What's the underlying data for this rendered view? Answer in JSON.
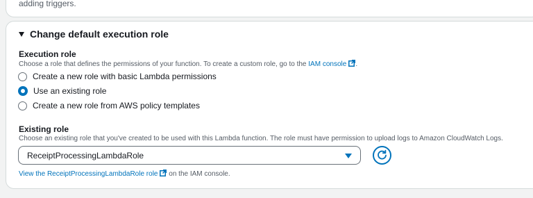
{
  "top_card": {
    "text": "adding triggers."
  },
  "section": {
    "title": "Change default execution role",
    "expanded": true
  },
  "execution_role": {
    "label": "Execution role",
    "description": "Choose a role that defines the permissions of your function. To create a custom role, go to the",
    "iam_link": "IAM console",
    "description_end": ".",
    "options": [
      {
        "label": "Create a new role with basic Lambda permissions",
        "checked": false
      },
      {
        "label": "Use an existing role",
        "checked": true
      },
      {
        "label": "Create a new role from AWS policy templates",
        "checked": false
      }
    ]
  },
  "existing_role": {
    "label": "Existing role",
    "description": "Choose an existing role that you've created to be used with this Lambda function. The role must have permission to upload logs to Amazon CloudWatch Logs.",
    "selected_value": "ReceiptProcessingLambdaRole",
    "view_link": "View the ReceiptProcessingLambdaRole role",
    "view_suffix": "on the IAM console."
  },
  "colors": {
    "link": "#0073bb",
    "text": "#16191f",
    "secondary_text": "#545b64",
    "border": "#d5dbdb"
  },
  "icons": [
    "caret-down-icon",
    "external-link-icon",
    "dropdown-caret-icon",
    "refresh-icon"
  ]
}
